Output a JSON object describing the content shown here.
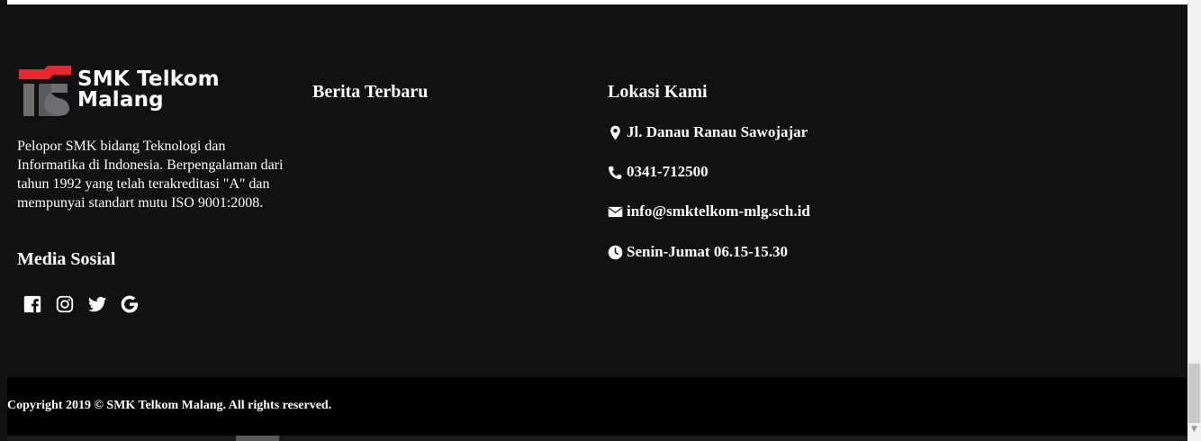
{
  "brand": {
    "logo_line1": "SMK Telkom",
    "logo_line2": "Malang",
    "colors": {
      "red": "#e8262c",
      "gray": "#6d6e71",
      "footer_bg": "#111111",
      "copyright_bg": "#000000"
    }
  },
  "about": {
    "description": "Pelopor SMK bidang Teknologi dan Informatika di Indonesia. Berpengalaman dari tahun 1992 yang telah terakreditasi \"A\" dan mempunyai standart mutu ISO 9001:2008."
  },
  "social": {
    "heading": "Media Sosial",
    "icons": [
      "facebook-icon",
      "instagram-icon",
      "twitter-icon",
      "google-icon"
    ]
  },
  "news": {
    "heading": "Berita Terbaru"
  },
  "location": {
    "heading": "Lokasi Kami",
    "address": "Jl. Danau Ranau Sawojajar",
    "phone": "0341-712500",
    "email": "info@smktelkom-mlg.sch.id",
    "hours": "Senin-Jumat 06.15-15.30",
    "icons": [
      "map-marker-icon",
      "phone-icon",
      "envelope-icon",
      "clock-icon"
    ]
  },
  "footer": {
    "copyright": "Copyright 2019 © SMK Telkom Malang. All rights reserved."
  }
}
